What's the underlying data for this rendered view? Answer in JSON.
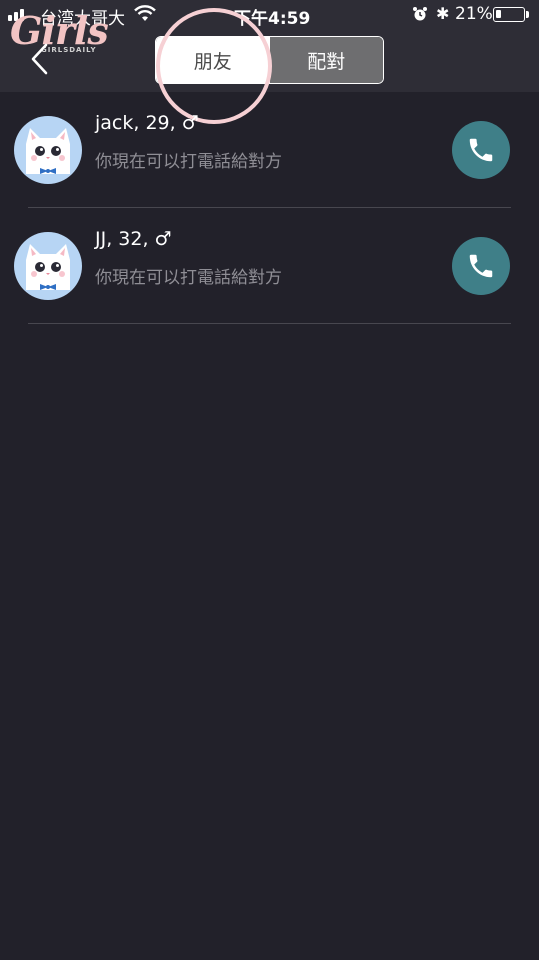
{
  "status_bar": {
    "carrier": "台湾大哥大",
    "time": "下午4:59",
    "battery_percent": "21%",
    "battery_level": 0.21,
    "icons": [
      "signal-icon",
      "wifi-icon",
      "alarm-icon",
      "bluetooth-icon",
      "battery-icon"
    ]
  },
  "watermark": {
    "word": "Girls",
    "sub": "GIRLSDAILY"
  },
  "header": {
    "back_icon": "chevron-left-icon",
    "tabs": [
      {
        "label": "朋友",
        "active": true
      },
      {
        "label": "配對",
        "active": false
      }
    ]
  },
  "contacts": [
    {
      "name": "jack, 29, ♂",
      "subtitle": "你現在可以打電話給對方",
      "action_icon": "phone-icon"
    },
    {
      "name": "JJ, 32, ♂",
      "subtitle": "你現在可以打電話給對方",
      "action_icon": "phone-icon"
    }
  ],
  "colors": {
    "background": "#22212a",
    "header": "#2e2d36",
    "call_button": "#3f7f88",
    "avatar_bg": "#b7d5f4",
    "highlight": "#f6d0d4"
  }
}
